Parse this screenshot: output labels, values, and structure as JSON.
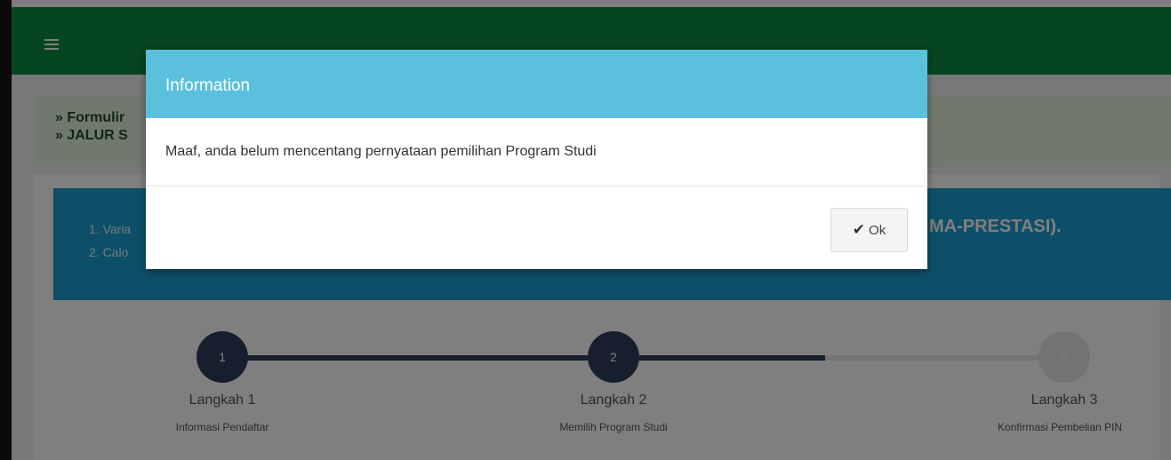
{
  "navbar": {
    "menu_icon": "hamburger-menu-icon"
  },
  "breadcrumb": {
    "line1": "» Formulir",
    "line2": "» JALUR S"
  },
  "info_box": {
    "line1": "1. Varia",
    "line2": "2. Calo",
    "highlight": "MA-PRESTASI)."
  },
  "steps": [
    {
      "number": "1",
      "title": "Langkah 1",
      "subtitle": "Informasi Pendaftar"
    },
    {
      "number": "2",
      "title": "Langkah 2",
      "subtitle": "Memilih Program Studi"
    },
    {
      "number": "3",
      "title": "Langkah 3",
      "subtitle": "Konfirmasi Pembelian PIN"
    }
  ],
  "modal": {
    "title": "Information",
    "message": "Maaf, anda belum mencentang pernyataan pemilihan Program Studi",
    "ok_label": "Ok",
    "ok_icon": "check-icon"
  },
  "colors": {
    "navbar": "#0b8a3e",
    "modal_header": "#5bc0de",
    "info_box": "#1a9ed1",
    "step_active": "#2e3f5c"
  }
}
